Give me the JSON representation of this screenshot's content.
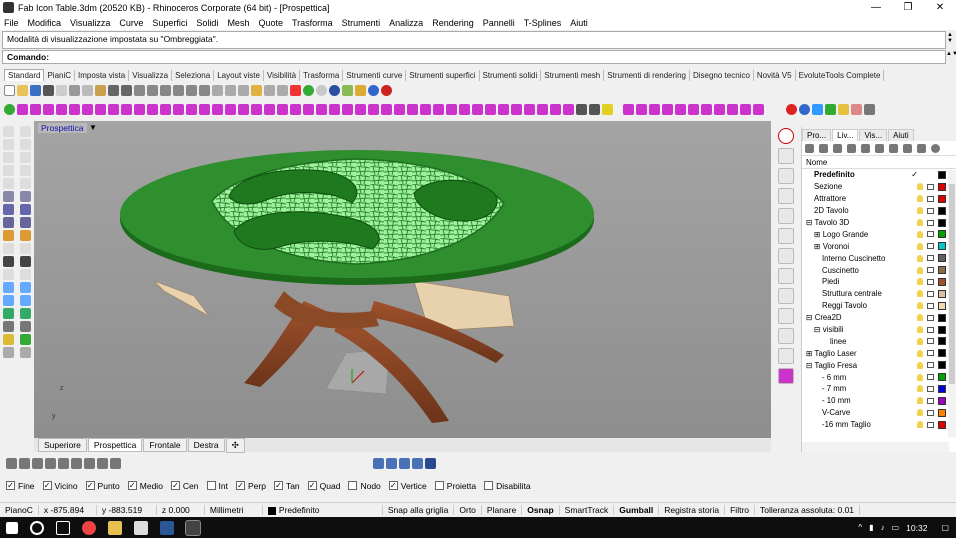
{
  "window": {
    "title": "Fab Icon Table.3dm (20520 KB) - Rhinoceros Corporate (64 bit) - [Prospettica]",
    "minimize": "—",
    "maximize": "❐",
    "close": "✕"
  },
  "menu": [
    "File",
    "Modifica",
    "Visualizza",
    "Curve",
    "Superfici",
    "Solidi",
    "Mesh",
    "Quote",
    "Trasforma",
    "Strumenti",
    "Analizza",
    "Rendering",
    "Pannelli",
    "T-Splines",
    "Aiuti"
  ],
  "command": {
    "history": "Modalità di visualizzazione impostata su \"Ombreggiata\".",
    "prompt": "Comando:"
  },
  "toolbar_tabs": [
    "Standard",
    "PianiC",
    "Imposta vista",
    "Visualizza",
    "Seleziona",
    "Layout viste",
    "Visibilità",
    "Trasforma",
    "Strumenti curve",
    "Strumenti superfici",
    "Strumenti solidi",
    "Strumenti mesh",
    "Strumenti di rendering",
    "Disegno tecnico",
    "Novità V5",
    "EvoluteTools Complete"
  ],
  "viewport": {
    "name": "Prospettica",
    "axis_z": "z",
    "axis_y": "y",
    "tabs": [
      "Superiore",
      "Prospettica",
      "Frontale",
      "Destra"
    ],
    "add_tab": "✣"
  },
  "panel": {
    "tabs": [
      "Pro...",
      "Liv...",
      "Vis...",
      "Aiuti"
    ],
    "column_name": "Nome",
    "layers": [
      {
        "name": "Predefinito",
        "indent": 1,
        "color": "#000000",
        "bold": true,
        "check": "✓"
      },
      {
        "name": "Sezione",
        "indent": 1,
        "color": "#e00000"
      },
      {
        "name": "Attrattore",
        "indent": 1,
        "color": "#e00000"
      },
      {
        "name": "2D Tavolo",
        "indent": 1,
        "color": "#000000"
      },
      {
        "name": "⊟ Tavolo 3D",
        "indent": 0,
        "color": "#000000"
      },
      {
        "name": "⊞ Logo Grande",
        "indent": 1,
        "color": "#00a000"
      },
      {
        "name": "⊞ Voronoi",
        "indent": 1,
        "color": "#00c8c8"
      },
      {
        "name": "Interno Cuscinetto",
        "indent": 2,
        "color": "#606060"
      },
      {
        "name": "Cuscinetto",
        "indent": 2,
        "color": "#8b6a4a"
      },
      {
        "name": "Piedi",
        "indent": 2,
        "color": "#a0522d"
      },
      {
        "name": "Struttura centrale",
        "indent": 2,
        "color": "#d8c0a0"
      },
      {
        "name": "Reggi Tavolo",
        "indent": 2,
        "color": "#f0d8b0"
      },
      {
        "name": "⊟ Crea2D",
        "indent": 0,
        "color": "#000000"
      },
      {
        "name": "⊟ visibili",
        "indent": 1,
        "color": "#000000"
      },
      {
        "name": "linee",
        "indent": 3,
        "color": "#000000"
      },
      {
        "name": "⊞ Taglio Laser",
        "indent": 0,
        "color": "#000000"
      },
      {
        "name": "⊟ Taglio Fresa",
        "indent": 0,
        "color": "#000000"
      },
      {
        "name": "- 6 mm",
        "indent": 2,
        "color": "#00a000"
      },
      {
        "name": "- 7 mm",
        "indent": 2,
        "color": "#0000e0"
      },
      {
        "name": "- 10 mm",
        "indent": 2,
        "color": "#a000c0"
      },
      {
        "name": "V-Carve",
        "indent": 2,
        "color": "#ff8000"
      },
      {
        "name": "-16 mm Taglio",
        "indent": 2,
        "color": "#e00000"
      }
    ]
  },
  "osnap": [
    {
      "label": "Fine",
      "checked": true
    },
    {
      "label": "Vicino",
      "checked": true
    },
    {
      "label": "Punto",
      "checked": true
    },
    {
      "label": "Medio",
      "checked": true
    },
    {
      "label": "Cen",
      "checked": true
    },
    {
      "label": "Int",
      "checked": false
    },
    {
      "label": "Perp",
      "checked": true
    },
    {
      "label": "Tan",
      "checked": true
    },
    {
      "label": "Quad",
      "checked": true
    },
    {
      "label": "Nodo",
      "checked": false
    },
    {
      "label": "Vertice",
      "checked": true
    },
    {
      "label": "Proietta",
      "checked": false
    },
    {
      "label": "Disabilita",
      "checked": false
    }
  ],
  "status": {
    "cplane": "PianoC",
    "x": "x -875.894",
    "y": "y -883.519",
    "z": "z 0.000",
    "units": "Millimetri",
    "layer": "Predefinito",
    "items": [
      {
        "label": "Snap alla griglia",
        "bold": false
      },
      {
        "label": "Orto",
        "bold": false
      },
      {
        "label": "Planare",
        "bold": false
      },
      {
        "label": "Osnap",
        "bold": true
      },
      {
        "label": "SmartTrack",
        "bold": false
      },
      {
        "label": "Gumball",
        "bold": true
      },
      {
        "label": "Registra storia",
        "bold": false
      },
      {
        "label": "Filtro",
        "bold": false
      },
      {
        "label": "Tolleranza assoluta: 0.01",
        "bold": false
      }
    ]
  },
  "taskbar": {
    "clock": "10:32"
  }
}
